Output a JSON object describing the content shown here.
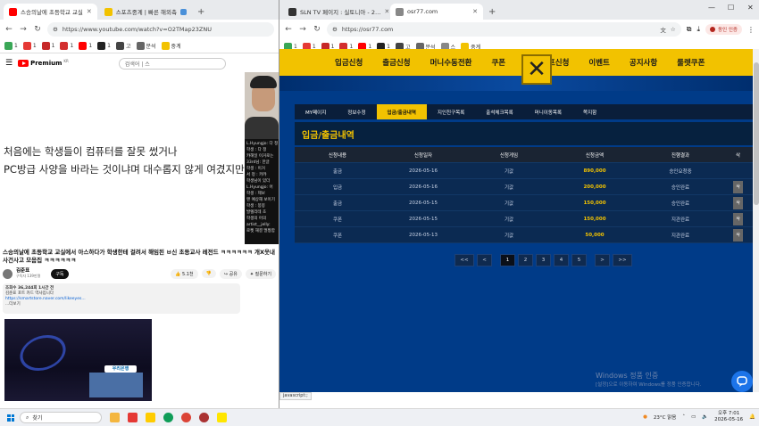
{
  "left_window": {
    "tabs": [
      {
        "title": "스승의날에 초등학교 교실",
        "fav_color": "#ff0000",
        "active": true
      },
      {
        "title": "스포츠중계 | 빠른 해외축",
        "fav_color": "#f2c200",
        "active": false
      }
    ],
    "url": "https://www.youtube.com/watch?v=O2TMap23ZNU",
    "bookmarks": [
      "1",
      "1",
      "1",
      "1",
      "1",
      "1",
      "고",
      "분석",
      "중계"
    ],
    "yt_brand": "Premium",
    "yt_region": "KR",
    "search_placeholder": "검색어 | 스",
    "subtitle_line1": "처음에는 학생들이 컴퓨터를 잘못 썼거나",
    "subtitle_line2": "PC방급 사양을 바라는 것이냐며 대수롭지 않게 여겼지만",
    "chat_lines": [
      "L.Hyungjo: 다 정",
      "학생 : 다 정",
      "캬해일 이거로는",
      "33rd님: 한글",
      "학생 : 이거",
      "서 정 : 캬캬",
      "학생님이 있더",
      "L.Hyungjo: 어",
      "학생 : 제보",
      "맨 예상해 보이기",
      "학생 : 봉봉",
      "발렐리테 초",
      "학생의 어의",
      "artist__jelly:",
      "로켓 해결 멀쩡함"
    ],
    "video_title": "스승의날에 초등학교 교실에서 아스하다가 학생한테 걸려서 해임된 ㅂ신 초등교사 레전드 ㅋㅋㅋㅋㅋㅋ 개X웃내 사건사고 모음집 ㅋㅋㅋㅋㅋㅋ",
    "channel_name": "김준표",
    "channel_subs": "구독자 139만명",
    "subscribe_label": "구독",
    "like_count": "5.1천",
    "share_label": "공유",
    "ask_label": "질문하기",
    "desc_views": "조회수 36,244회 1시간 전",
    "desc_line": "김준표 포트 카드 역사입니다",
    "desc_link": "https://smartstore.naver.com/likeeyes...",
    "desc_more": "...더보기",
    "thumb_bank": "우리은행"
  },
  "right_window": {
    "tabs": [
      {
        "title": "SLN TV 페이지 : 실토니아 - 2…",
        "fav_color": "#333333",
        "active": false
      },
      {
        "title": "osr77.com",
        "fav_color": "#888888",
        "active": true
      }
    ],
    "url": "https://osr77.com",
    "profile_label": "동인 인증",
    "bookmarks": [
      "1",
      "1",
      "1",
      "1",
      "1",
      "1",
      "고",
      "분석",
      "스",
      "중계"
    ],
    "site_nav": [
      "입금신청",
      "출금신청",
      "머니수동전환",
      "쿠폰",
      "콤프신청",
      "이벤트",
      "공지사항",
      "룰렛쿠폰"
    ],
    "sub_nav": [
      {
        "label": "MY페이지",
        "active": false
      },
      {
        "label": "정보수정",
        "active": false
      },
      {
        "label": "입금/출금내역",
        "active": true
      },
      {
        "label": "지인친구목록",
        "active": false
      },
      {
        "label": "출석체크목록",
        "active": false
      },
      {
        "label": "머니이동목록",
        "active": false
      },
      {
        "label": "쪽지함",
        "active": false
      }
    ],
    "page_title": "입금/출금내역",
    "table_headers": [
      "신청내용",
      "신청일자",
      "신청게임",
      "신청금액",
      "진행결과",
      "삭"
    ],
    "table_rows": [
      {
        "type": "출금",
        "date": "2026-05-16",
        "game": "기값",
        "amount": "890,000",
        "result": "승인요청중",
        "action": ""
      },
      {
        "type": "입금",
        "date": "2026-05-16",
        "game": "기값",
        "amount": "200,000",
        "result": "승인완료",
        "action": "삭"
      },
      {
        "type": "출금",
        "date": "2026-05-15",
        "game": "기값",
        "amount": "150,000",
        "result": "승인완료",
        "action": "삭"
      },
      {
        "type": "쿠폰",
        "date": "2026-05-15",
        "game": "기값",
        "amount": "150,000",
        "result": "지관완료",
        "action": "삭"
      },
      {
        "type": "쿠폰",
        "date": "2026-05-13",
        "game": "기값",
        "amount": "50,000",
        "result": "지관완료",
        "action": "삭"
      }
    ],
    "pagination": [
      "<<",
      "<",
      "1",
      "2",
      "3",
      "4",
      "5",
      ">",
      ">>"
    ],
    "current_page": "1",
    "activate_line1": "Windows 정품 인증",
    "activate_line2": "[설정]으로 이동하여 Windows를 정품 인증합니다.",
    "status_text": "javascript:;"
  },
  "taskbar": {
    "search_label": "찾기",
    "weather": "23°C 맑음",
    "time": "오후 7:01",
    "date": "2026-05-16"
  }
}
